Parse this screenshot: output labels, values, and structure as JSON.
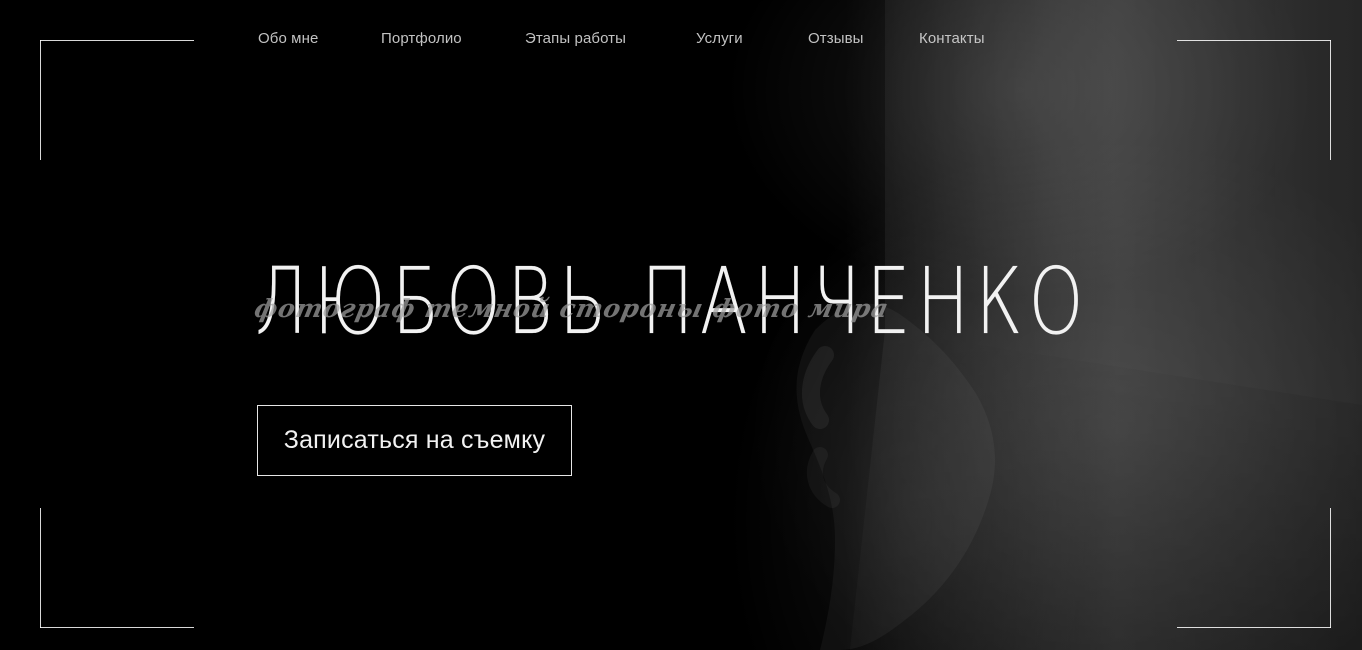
{
  "header": {
    "nav": [
      {
        "label": "Обо мне"
      },
      {
        "label": "Портфолио"
      },
      {
        "label": "Этапы работы"
      },
      {
        "label": "Услуги"
      },
      {
        "label": "Отзывы"
      },
      {
        "label": "Контакты"
      }
    ]
  },
  "hero": {
    "title": "ЛЮБОВЬ ПАНЧЕНКО",
    "subtitle": "фотограф темной стороны фото мира",
    "cta_label": "Записаться на съемку"
  },
  "colors": {
    "background": "#000000",
    "text": "#f2f2f2",
    "subtitle": "#a0a0a0"
  }
}
